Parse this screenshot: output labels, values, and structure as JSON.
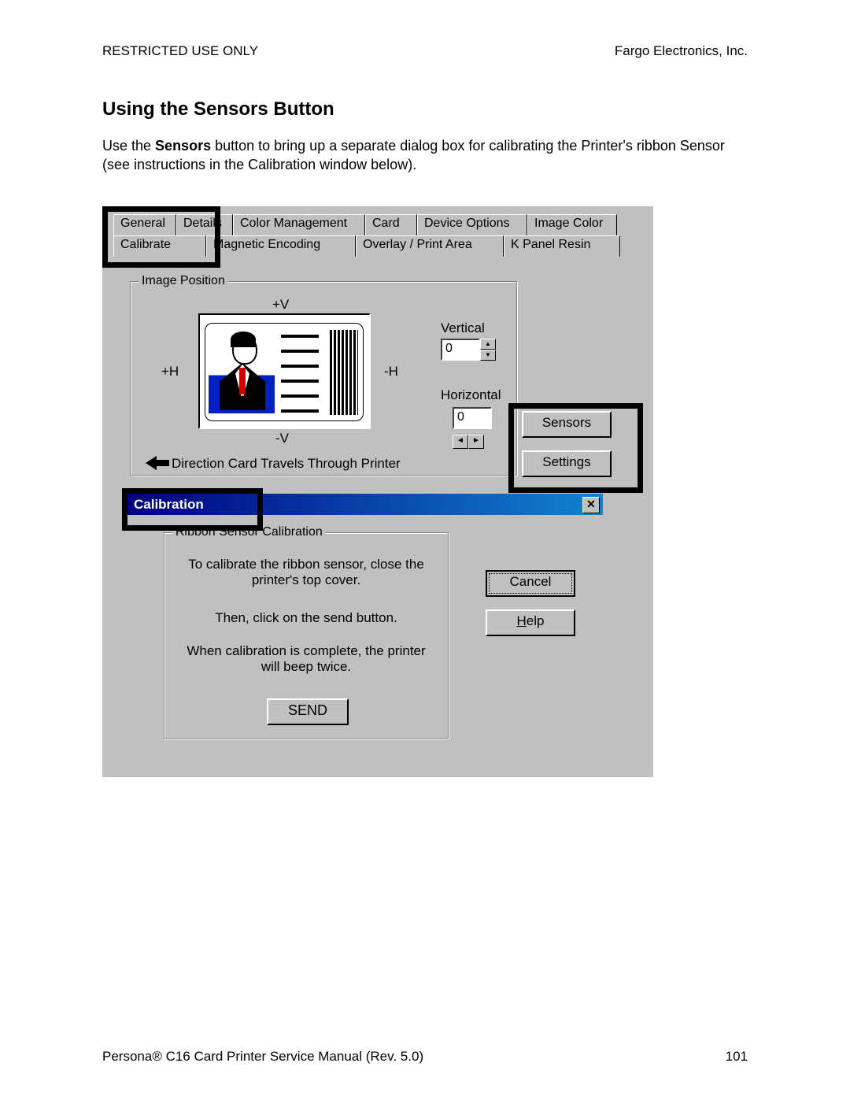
{
  "page": {
    "header_left": "RESTRICTED USE ONLY",
    "header_right": "Fargo Electronics, Inc.",
    "section_title": "Using the Sensors Button",
    "body_text_prefix": "Use the ",
    "body_text_bold": "Sensors",
    "body_text_suffix": " button to bring up a separate dialog box for calibrating the Printer's ribbon Sensor (see instructions in the Calibration window below).",
    "footer_left": "Persona® C16 Card Printer Service Manual (Rev. 5.0)",
    "footer_right": "101"
  },
  "tabs": {
    "row1": [
      "General",
      "Details",
      "Color Management",
      "Card",
      "Device Options",
      "Image Color"
    ],
    "row2": [
      "Calibrate",
      "Magnetic Encoding",
      "Overlay / Print Area",
      "K Panel Resin"
    ]
  },
  "image_position": {
    "group_label": "Image Position",
    "plus_v": "+V",
    "minus_v": "-V",
    "plus_h": "+H",
    "minus_h": "-H",
    "direction_text": "Direction Card Travels Through Printer",
    "vertical_label": "Vertical",
    "vertical_value": "0",
    "horizontal_label": "Horizontal",
    "horizontal_value": "0"
  },
  "buttons": {
    "sensors": "Sensors",
    "settings": "Settings"
  },
  "calibration": {
    "title": "Calibration",
    "group_label": "Ribbon Sensor Calibration",
    "text1": "To calibrate the ribbon sensor, close the printer's top cover.",
    "text2": "Then, click on the send button.",
    "text3": "When calibration is complete, the printer will beep twice.",
    "send": "SEND",
    "cancel": "Cancel",
    "help": "Help"
  }
}
